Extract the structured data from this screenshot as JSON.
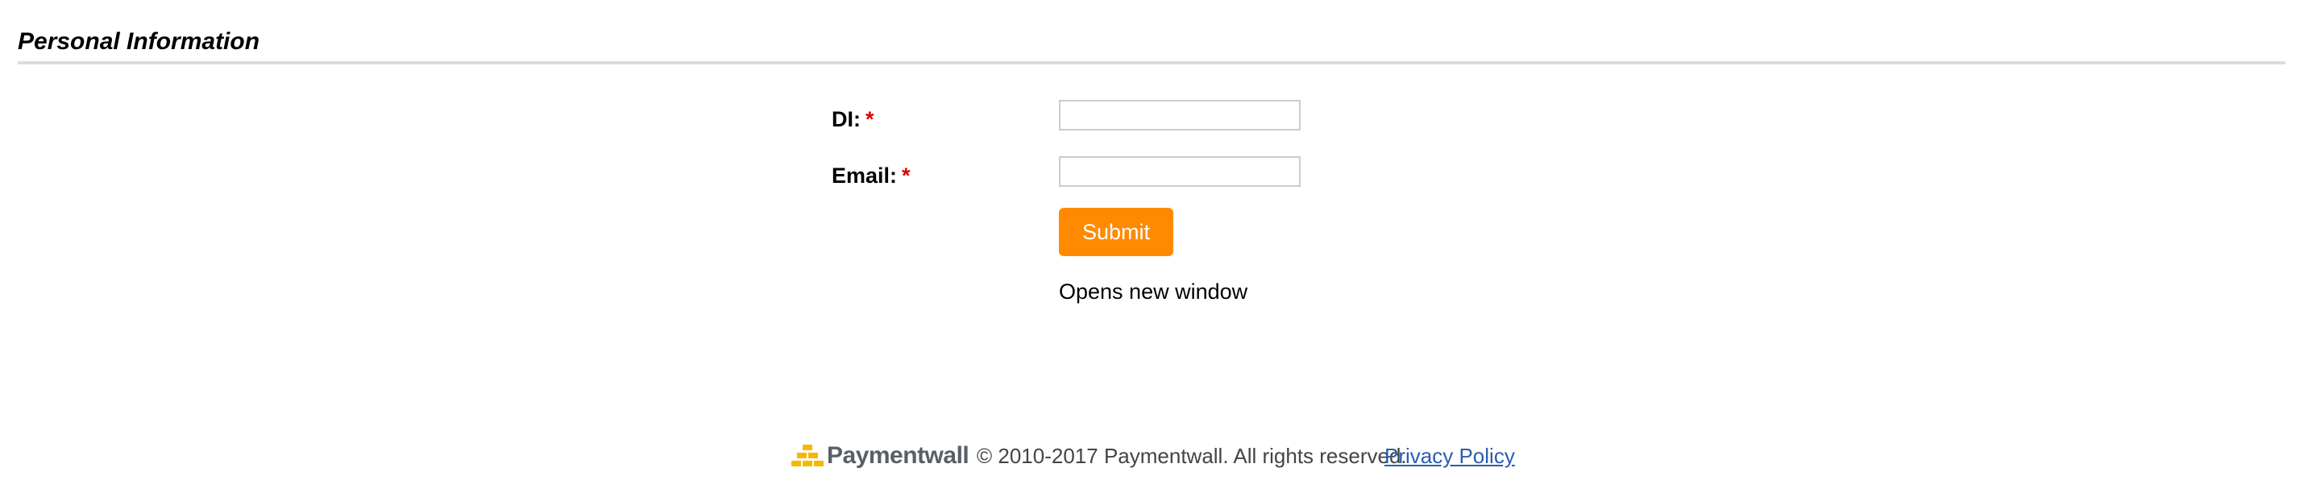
{
  "section": {
    "title": "Personal Information"
  },
  "form": {
    "required_marker": "*",
    "fields": [
      {
        "label": "DI:",
        "value": "",
        "placeholder": ""
      },
      {
        "label": "Email:",
        "value": "",
        "placeholder": ""
      }
    ],
    "submit_label": "Submit",
    "note": "Opens new window"
  },
  "footer": {
    "logo_text": "Paymentwall",
    "copyright": "© 2010-2017 Paymentwall. All rights reserved.",
    "privacy_link": "Privacy Policy"
  },
  "colors": {
    "accent": "#ff8a00",
    "required": "#e00000",
    "link": "#2a5db0",
    "logo_icon": "#f5b800"
  },
  "icons": {
    "logo": "paymentwall-logo-icon"
  }
}
